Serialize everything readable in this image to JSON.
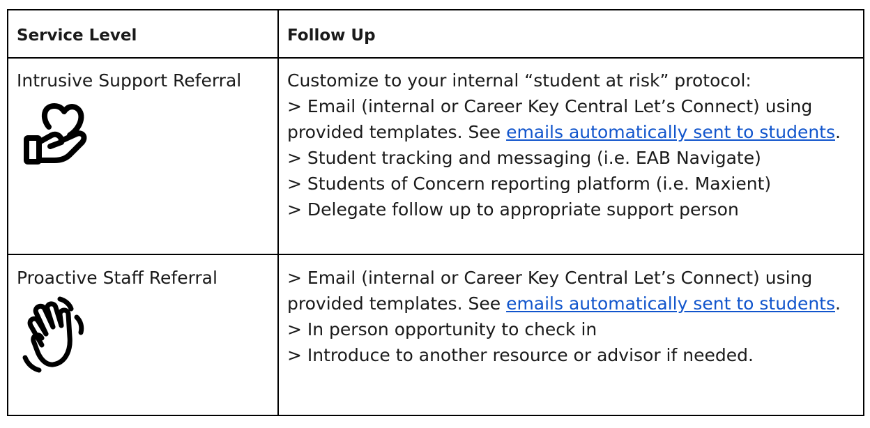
{
  "table": {
    "headers": {
      "service_level": "Service Level",
      "follow_up": "Follow Up"
    },
    "rows": [
      {
        "service_level": "Intrusive Support Referral",
        "icon": "hand-holding-heart-icon",
        "follow_up": {
          "intro": "Customize to your internal “student at risk” protocol:",
          "email_line_prefix": "> Email (internal or Career Key Central Let’s Connect) using provided templates. See ",
          "link_text": "emails automatically sent to students",
          "email_line_suffix": ".",
          "items": [
            "> Student tracking and messaging (i.e. EAB Navigate)",
            "> Students of Concern reporting platform (i.e. Maxient)",
            "> Delegate follow up to appropriate support person"
          ]
        }
      },
      {
        "service_level": "Proactive Staff Referral",
        "icon": "waving-hand-icon",
        "follow_up": {
          "email_line_prefix": "> Email (internal or Career Key Central Let’s Connect) using provided templates. See ",
          "link_text": "emails automatically sent to students",
          "email_line_suffix": ".",
          "items": [
            "> In person opportunity to check in",
            "> Introduce to another resource or advisor if needed."
          ]
        }
      }
    ]
  },
  "colors": {
    "link": "#1155cc",
    "border": "#000000"
  }
}
